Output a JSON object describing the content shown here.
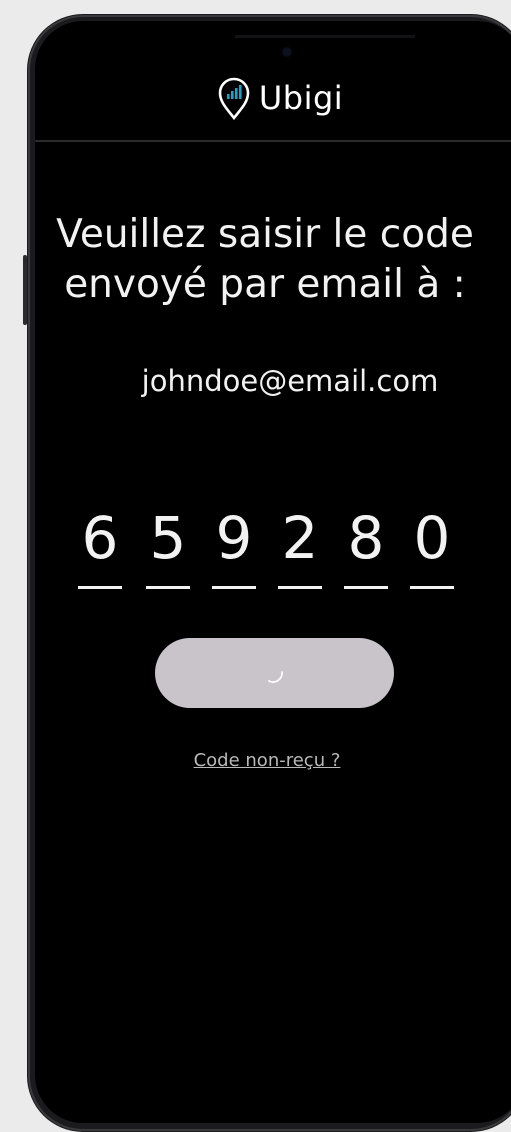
{
  "header": {
    "brand": "Ubigi",
    "logo_icon": "location-pin-signal-icon",
    "accent_color": "#1ba3c6"
  },
  "main": {
    "instruction_line1": "Veuillez saisir le code",
    "instruction_line2": "envoyé par email à :",
    "email": "johndoe@email.com",
    "code_digits": [
      "6",
      "5",
      "9",
      "2",
      "8",
      "0"
    ],
    "submit_button": {
      "state": "loading",
      "icon": "loading-spinner-icon"
    },
    "resend_link": "Code non-reçu ?"
  }
}
